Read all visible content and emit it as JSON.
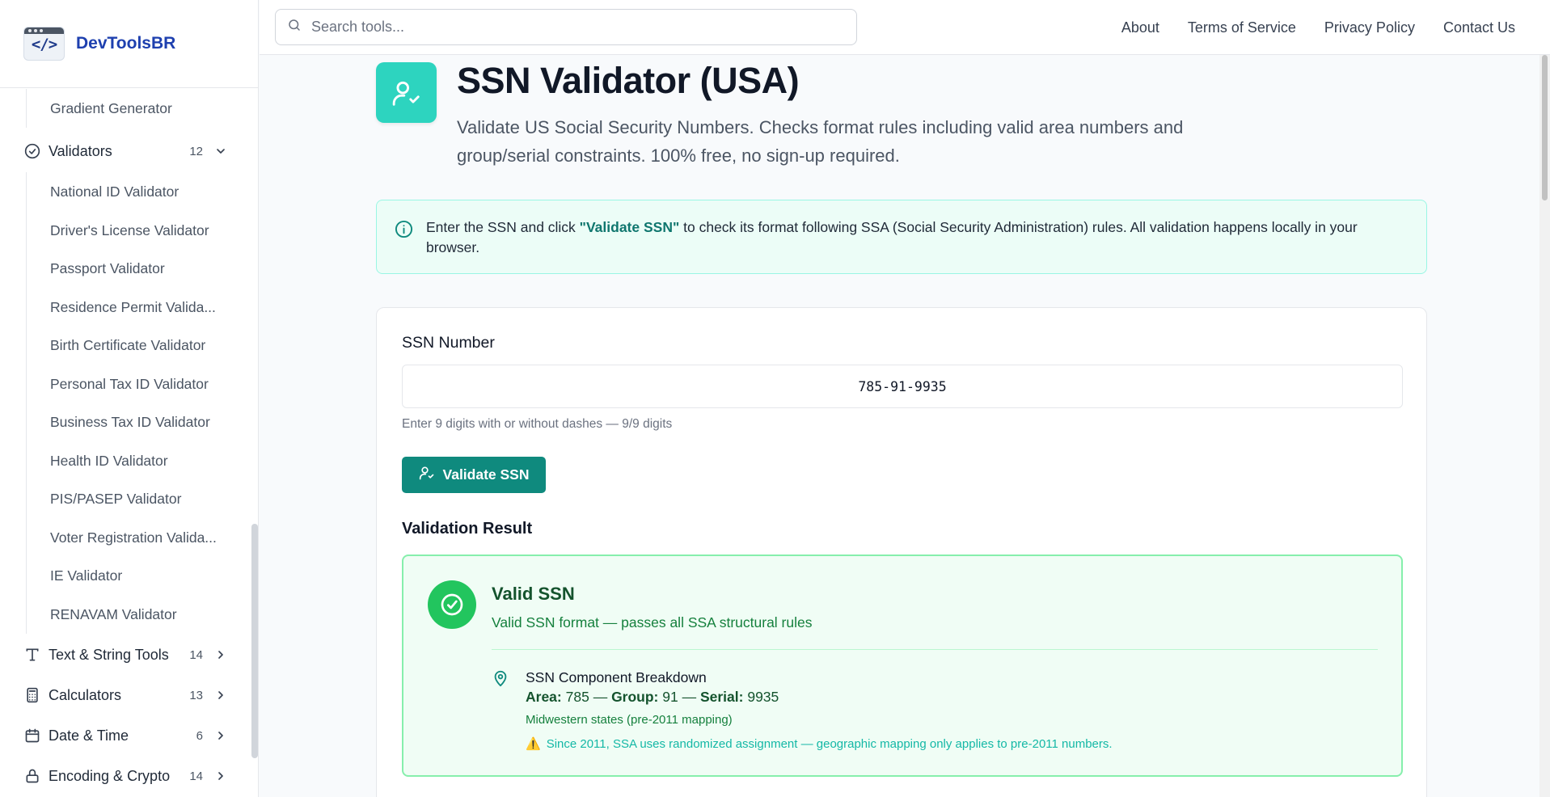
{
  "brand": {
    "name": "DevToolsBR",
    "logo_text": "</>"
  },
  "search": {
    "placeholder": "Search tools..."
  },
  "topnav": [
    "About",
    "Terms of Service",
    "Privacy Policy",
    "Contact Us"
  ],
  "sidebar": {
    "prev_item": "Gradient Generator",
    "validators": {
      "label": "Validators",
      "count": "12"
    },
    "validator_items": [
      "National ID Validator",
      "Driver's License Validator",
      "Passport Validator",
      "Residence Permit Valida...",
      "Birth Certificate Validator",
      "Personal Tax ID Validator",
      "Business Tax ID Validator",
      "Health ID Validator",
      "PIS/PASEP Validator",
      "Voter Registration Valida...",
      "IE Validator",
      "RENAVAM Validator"
    ],
    "categories": [
      {
        "label": "Text & String Tools",
        "count": "14",
        "icon": "text-icon"
      },
      {
        "label": "Calculators",
        "count": "13",
        "icon": "calculator-icon"
      },
      {
        "label": "Date & Time",
        "count": "6",
        "icon": "calendar-icon"
      },
      {
        "label": "Encoding & Crypto",
        "count": "14",
        "icon": "lock-icon"
      }
    ]
  },
  "page": {
    "title": "SSN Validator (USA)",
    "description": "Validate US Social Security Numbers. Checks format rules including valid area numbers and group/serial constraints. 100% free, no sign-up required."
  },
  "info": {
    "prefix": "Enter the SSN and click ",
    "highlight": "\"Validate SSN\"",
    "suffix": " to check its format following SSA (Social Security Administration) rules. All validation happens locally in your browser."
  },
  "form": {
    "label": "SSN Number",
    "value": "785-91-9935",
    "hint": "Enter 9 digits with or without dashes — 9/9 digits",
    "button": "Validate SSN"
  },
  "result": {
    "heading": "Validation Result",
    "status": "Valid SSN",
    "message": "Valid SSN format — passes all SSA structural rules",
    "breakdown_title": "SSN Component Breakdown",
    "area_label": "Area:",
    "area": "785",
    "group_label": "Group:",
    "group": "91",
    "serial_label": "Serial:",
    "serial": "9935",
    "sep": " — ",
    "region": "Midwestern states (pre-2011 mapping)",
    "warning": "Since 2011, SSA uses randomized assignment — geographic mapping only applies to pre-2011 numbers.",
    "warning_icon": "⚠️"
  },
  "colors": {
    "accent": "#0f8a7e",
    "icon_bg": "#2dd4bf",
    "success": "#22c55e"
  }
}
